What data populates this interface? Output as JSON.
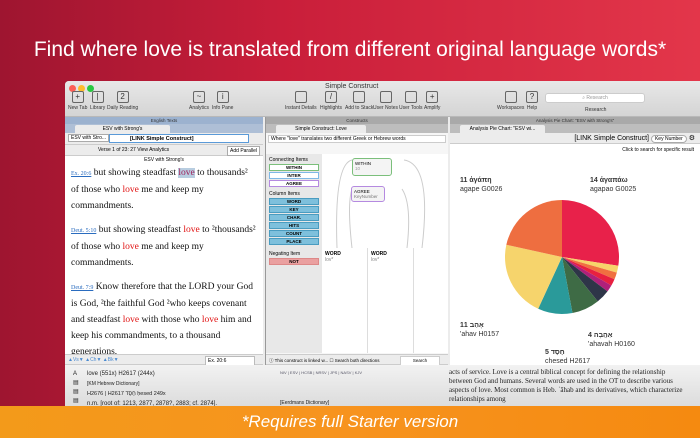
{
  "headline": "Find where love is translated from different original language words*",
  "footer": "*Requires full Starter version",
  "window": {
    "title": "Simple Construct"
  },
  "toolbar": {
    "left": [
      "New Tab",
      "Library",
      "Daily Reading"
    ],
    "mid": [
      "Analytics",
      "Info Pane"
    ],
    "center": [
      "Instant Details",
      "Highlights",
      "Add to Stack",
      "User Notes",
      "User Tools",
      "Amplify"
    ],
    "right": [
      "Workspaces",
      "Help"
    ],
    "search_placeholder": "Research",
    "search_label": "Research"
  },
  "left_pane": {
    "header": "English Texts",
    "tab": "ESV with Strong's",
    "version": "ESV with Stro...",
    "search_value": "[LINK Simple Construct]",
    "verse_info": "Verse 1 of 23:",
    "verse_count": "27",
    "view_analytics": "View Analytics",
    "add_parallel": "Add Parallel",
    "sub_title": "ESV with Strong's",
    "ref_field": "Ex. 20:6",
    "verses": [
      {
        "ref": "Ex. 20:6",
        "parts": [
          "but showing steadfast ",
          "love",
          " to thousands² of those who ",
          "love",
          " me and keep my commandments."
        ]
      },
      {
        "ref": "Deut. 5:10",
        "parts": [
          "but showing steadfast ",
          "love",
          " to ²thousands² of those who ",
          "love",
          " me and keep my commandments."
        ]
      },
      {
        "ref": "Deut. 7:9",
        "parts": [
          "Know therefore that the LORD your God is God, ²the faithful God ²who keeps covenant and steadfast ",
          "love",
          " with those who ",
          "love",
          " him and keep his commandments, to a thousand generations,"
        ]
      }
    ]
  },
  "mid_pane": {
    "header": "Constructs",
    "tab": "Simple Construct: Love",
    "description": "Where \"love\" translates two different Greek or Hebrew words",
    "connecting_label": "Connecting Items",
    "connecting": [
      "WITHIN",
      "INTER",
      "AGREE"
    ],
    "column_label": "Column Items",
    "columns": [
      "WORD",
      "KEY",
      "CHAR.",
      "HITS",
      "COUNT",
      "PLACE"
    ],
    "negating_label": "Negating Item",
    "negating": "NOT",
    "node1": {
      "title": "WITHIN",
      "sub": "10"
    },
    "node2": {
      "title": "AGREE",
      "sub": "KeyNumber"
    },
    "word_cols": [
      {
        "title": "WORD",
        "sub": "lov*"
      },
      {
        "title": "WORD",
        "sub": "lov*"
      }
    ],
    "status": "This construct is linked w...",
    "both_directions": "Search both directions",
    "search_btn": "Search"
  },
  "right_pane": {
    "header": "Analysis Pie Chart: \"ESV with Strong's\"",
    "tab": "Analysis Pie Chart: \"ESV wi...",
    "link": "[LINK Simple Construct]",
    "key_select": "Key Number",
    "hint": "Click to search for specific result"
  },
  "chart_data": {
    "type": "pie",
    "slices": [
      {
        "label": "14 ἀγαπάω agapao G0025",
        "value": 14,
        "color": "#e8214a"
      },
      {
        "label": "",
        "value": 1,
        "color": "#f7d46a"
      },
      {
        "label": "",
        "value": 1,
        "color": "#f07040"
      },
      {
        "label": "",
        "value": 1,
        "color": "#e82040"
      },
      {
        "label": "",
        "value": 1,
        "color": "#b0207a"
      },
      {
        "label": "",
        "value": 2,
        "color": "#2e3548"
      },
      {
        "label": "4 אַהֲבָה 'ahavah H0160",
        "value": 4,
        "color": "#3e6b45"
      },
      {
        "label": "5 חֶסֶד chesed H2617",
        "value": 5,
        "color": "#2a9a9a"
      },
      {
        "label": "11 אָהַב 'ahav H0157",
        "value": 11,
        "color": "#f6d46c"
      },
      {
        "label": "11 ἀγάπη agape G0026",
        "value": 11,
        "color": "#ee6e40"
      }
    ]
  },
  "bottom": {
    "entry": "love (551x)  H2617 (244x)",
    "dict1": "[KM Hebrew Dictionary]",
    "strongs": "H2676 | H2617  חֶסֶד  ḥesed  249x",
    "root": "n.m. [root of: 1213, 2877, 2878?, 2883; cf. 2874].",
    "versions": "NIV | ESV | HCSB | NRSV | JPS | NASV | KJV",
    "dict2": "[Eerdmans Dictionary]",
    "text": "acts of service. Love is a central biblical concept for defining the relationship between God and humans. Several words are used in the OT to describe various aspects of love. Most common is Heb. ʾāhab and its derivatives, which characterize relationships among"
  }
}
